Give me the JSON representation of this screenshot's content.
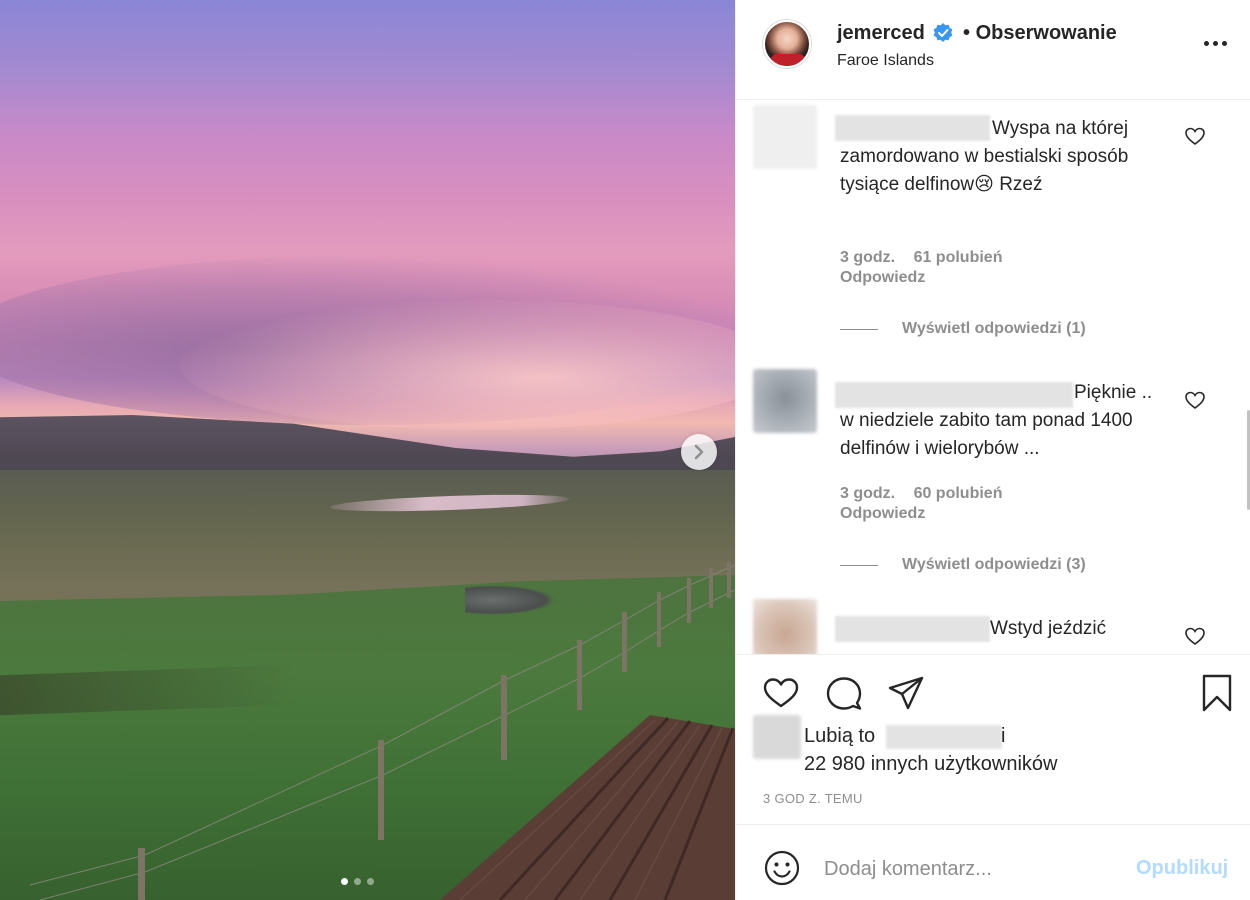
{
  "post": {
    "carousel": {
      "image_description_name": "sunset-landscape",
      "current_slide": 1,
      "total_slides": 3
    }
  },
  "header": {
    "username": "jemerced",
    "separator": "•",
    "follow_status": "Obserwowanie",
    "location": "Faroe Islands",
    "verified": true
  },
  "comments": [
    {
      "text": "Wyspa na której zamordowano w bestialski sposób tysiące delfinow😢 Rzeź",
      "time": "3 godz.",
      "likes": "61 polubień",
      "reply": "Odpowiedz",
      "view_replies": "Wyświetl odpowiedzi (1)"
    },
    {
      "text": "Pięknie .. w niedziele zabito tam ponad 1400 delfinów i wielorybów ...",
      "time": "3 godz.",
      "likes": "60 polubień",
      "reply": "Odpowiedz",
      "view_replies": "Wyświetl odpowiedzi (3)"
    },
    {
      "text": "Wstyd jeździć"
    }
  ],
  "likes": {
    "prefix": "Lubią to",
    "and": "i",
    "others": "22 980 innych użytkowników"
  },
  "timeago": "3 GOD Z. TEMU",
  "add_comment": {
    "placeholder": "Dodaj komentarz...",
    "publish_label": "Opublikuj"
  },
  "colors": {
    "accent_blue": "#0095f6",
    "publish_disabled": "#b3dbff",
    "secondary_text": "#8e8e8e",
    "primary_text": "#262626",
    "verified_badge": "#3897f0"
  }
}
